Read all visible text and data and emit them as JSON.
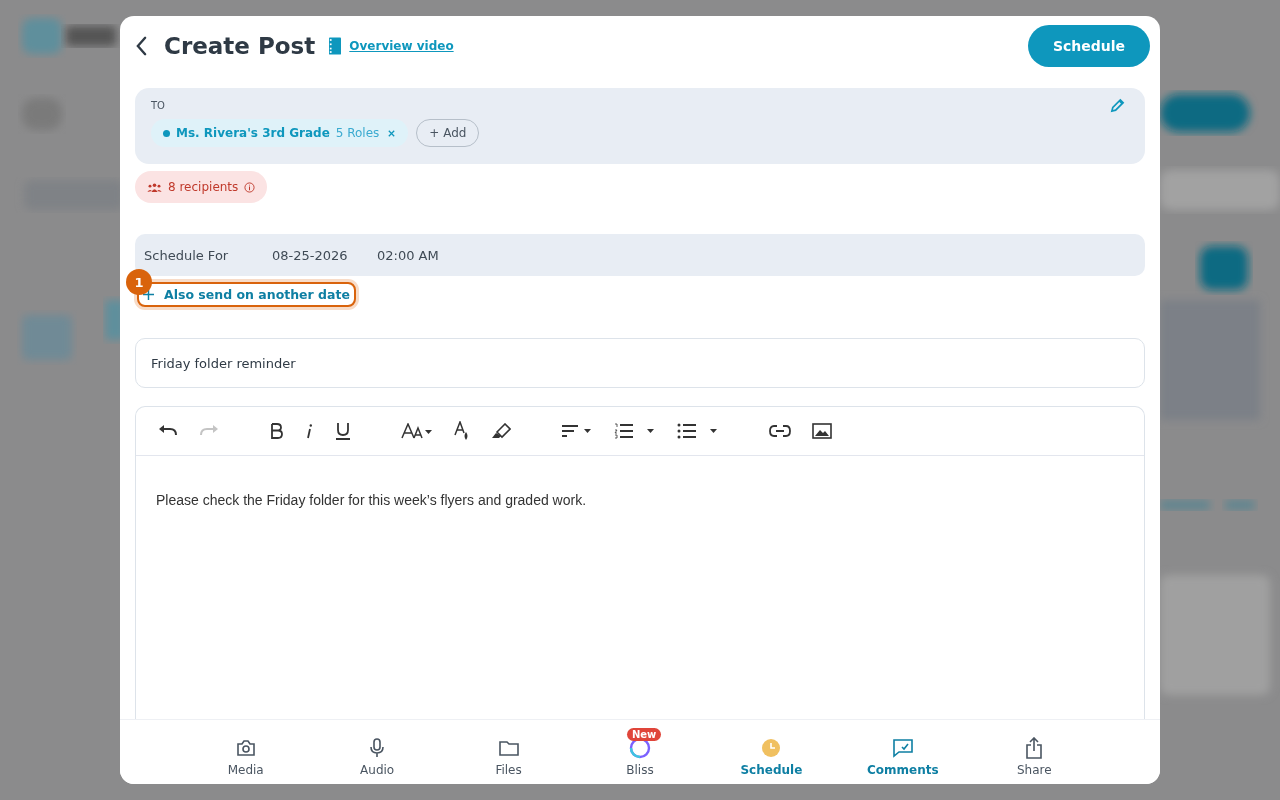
{
  "header": {
    "title": "Create Post",
    "video_link": "Overview video",
    "primary_button": "Schedule"
  },
  "recipients": {
    "label": "TO",
    "chips": [
      {
        "name": "Ms. Rivera's 3rd Grade",
        "detail": "5 Roles",
        "color": "#0e97bd"
      }
    ],
    "add_button": "+ Add",
    "count": "8 recipients"
  },
  "schedule": {
    "label": "Schedule For",
    "date": "08-25-2026",
    "time": "02:00 AM",
    "add_date_link": "Also send on another date",
    "step_marker": "1",
    "highlighted": true
  },
  "subject": {
    "value": "Friday folder reminder"
  },
  "editor": {
    "toolbar": [
      {
        "kind": "undo",
        "disabled": false
      },
      {
        "kind": "redo",
        "disabled": true
      },
      {
        "kind": "bold",
        "disabled": false
      },
      {
        "kind": "italic",
        "disabled": false
      },
      {
        "kind": "underline",
        "disabled": false
      },
      {
        "kind": "font-size",
        "disabled": false
      },
      {
        "kind": "text-color",
        "disabled": false
      },
      {
        "kind": "highlight",
        "disabled": false
      },
      {
        "kind": "align",
        "disabled": false
      },
      {
        "kind": "numbered-list",
        "disabled": false
      },
      {
        "kind": "bullet-list",
        "disabled": false
      },
      {
        "kind": "link",
        "disabled": false
      },
      {
        "kind": "image",
        "disabled": false
      }
    ],
    "body": "Please check the Friday folder for this week’s flyers and graded work."
  },
  "bottom_bar": [
    {
      "kind": "media",
      "label": "Media",
      "active": false
    },
    {
      "kind": "audio",
      "label": "Audio",
      "active": false
    },
    {
      "kind": "files",
      "label": "Files",
      "active": false
    },
    {
      "kind": "bliss",
      "label": "Bliss",
      "active": false,
      "badge": "New"
    },
    {
      "kind": "schedule",
      "label": "Schedule",
      "active": true
    },
    {
      "kind": "comments",
      "label": "Comments",
      "active": true
    },
    {
      "kind": "share",
      "label": "Share",
      "active": false
    }
  ]
}
